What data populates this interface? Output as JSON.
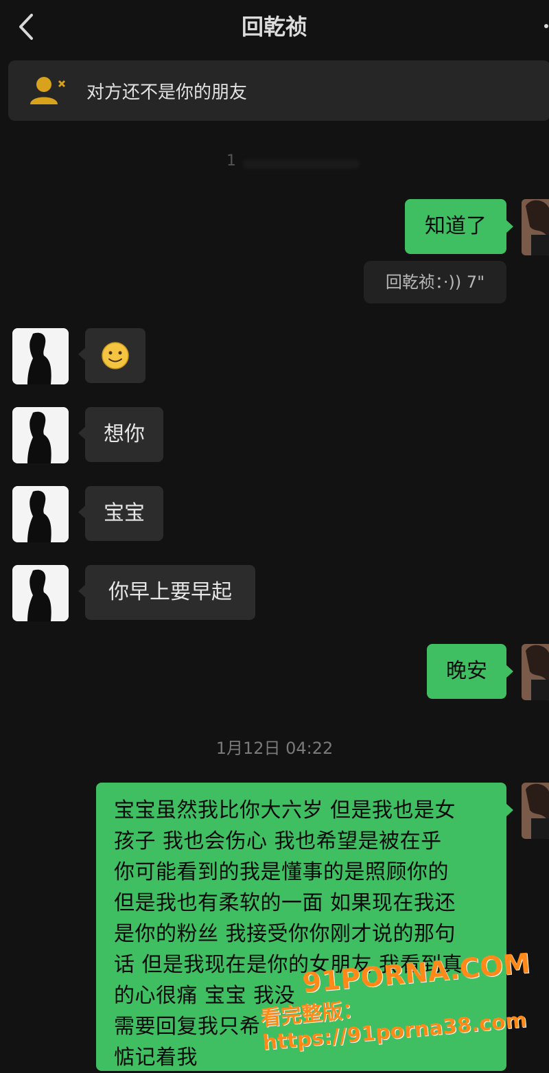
{
  "header": {
    "title": "回乾祯",
    "back_icon": "chevron-left-icon",
    "more_icon": "more-icon"
  },
  "banner": {
    "text": "对方还不是你的朋友",
    "icon": "user-not-friend-icon",
    "icon_color": "#d9a21c"
  },
  "timestamps": {
    "first": "1",
    "second": "1月12日 04:22"
  },
  "messages": [
    {
      "side": "out",
      "text": "知道了"
    },
    {
      "side": "tag",
      "text": "回乾祯：·)) 7\""
    },
    {
      "side": "in",
      "emoji": "smile-emoji"
    },
    {
      "side": "in",
      "text": "想你"
    },
    {
      "side": "in",
      "text": "宝宝"
    },
    {
      "side": "in",
      "text": "你早上要早起"
    },
    {
      "side": "out",
      "text": "晚安"
    },
    {
      "side": "out",
      "lines": [
        "宝宝虽然我比你大六岁 但是我也是女",
        "孩子 我也会伤心 我也希望是被在乎",
        "你可能看到的我是懂事的是照顾你的",
        "但是我也有柔软的一面  如果现在我还",
        "是你的粉丝 我接受你你刚才说的那句",
        "话 但是我现在是你的女朋友 我看到真",
        "的心很痛 宝宝 我没",
        "需要回复我只希",
        "惦记着我"
      ]
    }
  ],
  "watermark": {
    "brand": "91PORNA.COM",
    "line": "看完整版：https://91porna38.com"
  },
  "colors": {
    "background": "#121212",
    "outgoing": "#3fbf62",
    "incoming": "#2c2c2c",
    "accent": "#ff8a1a"
  }
}
